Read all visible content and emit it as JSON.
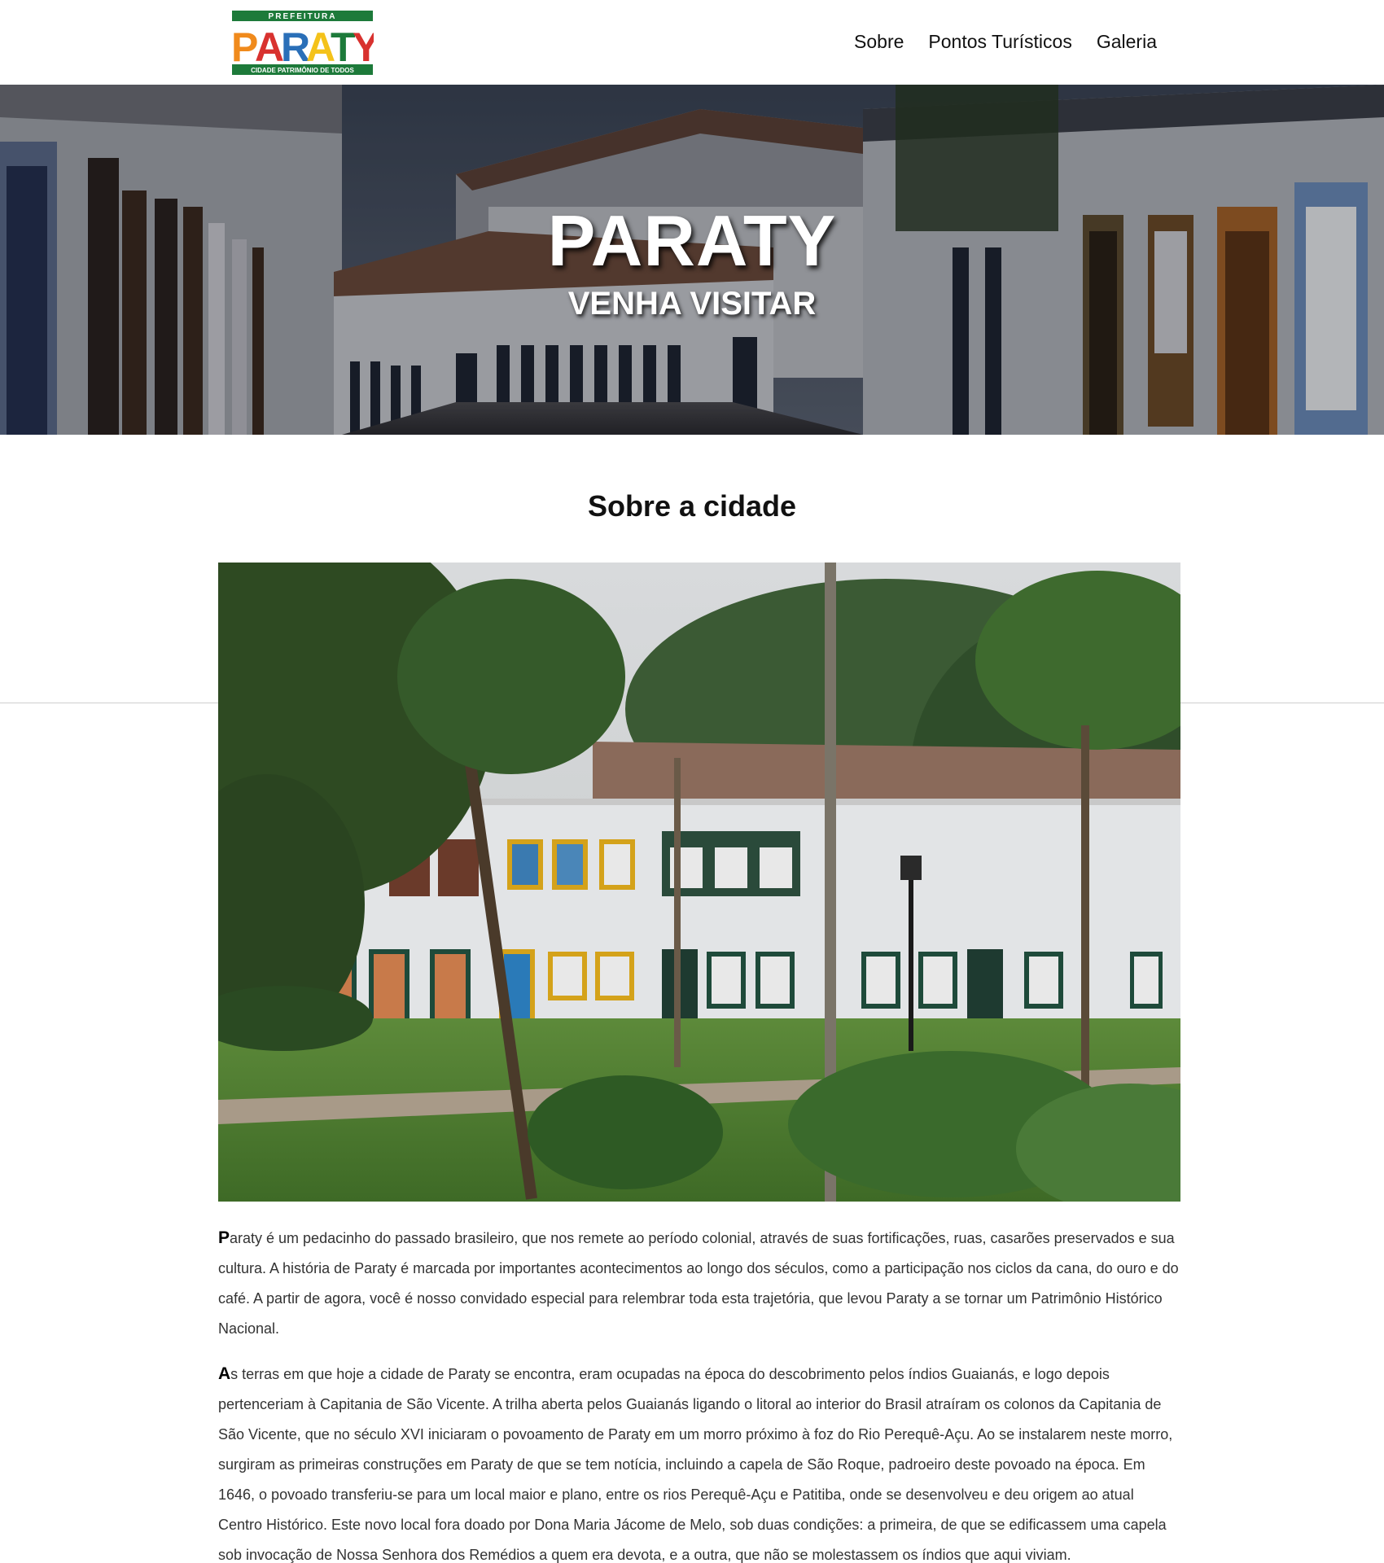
{
  "logo": {
    "top": "PREFEITURA",
    "word": "PARATY",
    "bottom": "CIDADE PATRIMÔNIO DE TODOS"
  },
  "nav": {
    "items": [
      {
        "label": "Sobre"
      },
      {
        "label": "Pontos Turísticos"
      },
      {
        "label": "Galeria"
      }
    ]
  },
  "hero": {
    "title": "PARATY",
    "subtitle": "VENHA VISITAR"
  },
  "about": {
    "title": "Sobre a cidade",
    "p1_initial": "P",
    "p1_rest": "araty é um pedacinho do passado brasileiro, que nos remete ao período colonial, através de suas fortificações, ruas, casarões preservados e sua cultura. A história de Paraty é marcada por importantes acontecimentos ao longo dos séculos, como a participação nos ciclos da cana, do ouro e do café. A partir de agora, você é nosso convidado especial para relembrar toda esta trajetória, que levou Paraty a se tornar um Patrimônio Histórico Nacional.",
    "p2_initial": "A",
    "p2_rest": "s terras em que hoje a cidade de Paraty se encontra, eram ocupadas na época do descobrimento pelos índios Guaianás, e logo depois pertenceriam à Capitania de São Vicente. A trilha aberta pelos Guaianás ligando o litoral ao interior do Brasil atraíram os colonos da Capitania de São Vicente, que no século XVI iniciaram o povoamento de Paraty em um morro próximo à foz do Rio Perequê-Açu. Ao se instalarem neste morro, surgiram as primeiras construções em Paraty de que se tem notícia, incluindo a capela de São Roque, padroeiro deste povoado na época. Em 1646, o povoado transferiu-se para um local maior e plano, entre os rios Perequê-Açu e Patitiba, onde se desenvolveu e deu origem ao atual Centro Histórico. Este novo local fora doado por Dona Maria Jácome de Melo, sob duas condições: a primeira, de que se edificassem uma capela sob invocação de Nossa Senhora dos Remédios a quem era devota, e a outra, que não se molestassem os índios que aqui viviam."
  },
  "colors": {
    "logo_green": "#1d7a3a",
    "logo_orange": "#f08a1c",
    "logo_blue": "#2a6fb8",
    "logo_red": "#d8322f",
    "logo_yellow": "#f4c21a"
  }
}
